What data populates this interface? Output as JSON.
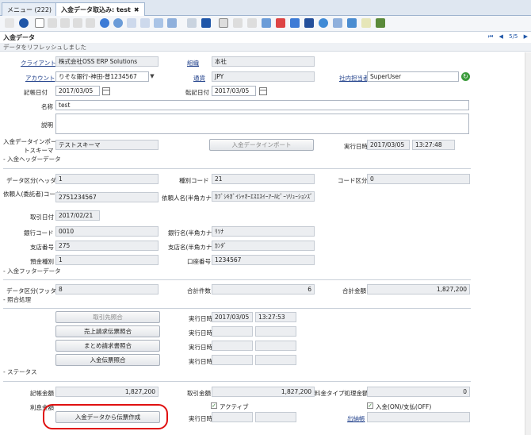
{
  "tabs": [
    {
      "label": "メニュー (222)"
    },
    {
      "label": "入金データ取込み: test",
      "close": "✖"
    }
  ],
  "header": {
    "title": "入金データ",
    "pager": {
      "count": "5/5"
    }
  },
  "status_message": "データをリフレッシュしました",
  "form": {
    "client_label": "クライアント",
    "client_value": "株式会社OSS ERP Solutions",
    "org_label": "組織",
    "org_value": "本社",
    "account_label": "アカウント",
    "account_value": "りそな銀行-神田-普1234567",
    "currency_label": "通貨",
    "currency_value": "JPY",
    "staff_label": "社内担当者",
    "staff_value": "SuperUser",
    "doc_date_label": "記帳日付",
    "doc_date_value": "2017/03/05",
    "acct_date_label": "転記日付",
    "acct_date_value": "2017/03/05",
    "name_label": "名称",
    "name_value": "test",
    "desc_label": "説明",
    "schema_label_1": "入金データインポー",
    "schema_label_2": "トスキーマ",
    "schema_value": "テストスキーマ",
    "import_button": "入金データインポート",
    "exec_label": "実行日時",
    "exec_date": "2017/03/05",
    "exec_time": "13:27:48"
  },
  "header_section": {
    "title": "- 入金ヘッダーデータ",
    "data_type_label": "データ区分(ヘッダ",
    "data_type_value": "1",
    "kind_code_label": "種別コード",
    "kind_code_value": "21",
    "code_type_label": "コード区分",
    "code_type_value": "0",
    "requester_code_label": "依頼人(委託者)コード",
    "requester_code_value": "2751234567",
    "requester_name_label": "依頼人名(半角カナ",
    "requester_name_value": "ｶﾌﾞｼｷｶﾞｲｼｬｵｰｴｽｴｽｲｰｱｰﾙﾋﾟｰｿﾘｭｰｼｮﾝｽﾞ",
    "trade_date_label": "取引日付",
    "trade_date_value": "2017/02/21",
    "bank_code_label": "銀行コード",
    "bank_code_value": "0010",
    "bank_name_label": "銀行名(半角カナ",
    "bank_name_value": "ﾘｿﾅ",
    "branch_no_label": "支店番号",
    "branch_no_value": "275",
    "branch_name_label": "支店名(半角カナ",
    "branch_name_value": "ｶﾝﾀﾞ",
    "deposit_type_label": "預金種別",
    "deposit_type_value": "1",
    "account_no_label": "口座番号",
    "account_no_value": "1234567"
  },
  "footer_section": {
    "title": "- 入金フッターデータ",
    "data_type_label": "データ区分(フッタ",
    "data_type_value": "8",
    "total_count_label": "合計件数",
    "total_count_value": "6",
    "total_amount_label": "合計金額",
    "total_amount_value": "1,827,200"
  },
  "match_section": {
    "title": "- 照合処理",
    "btn1": "取引先照合",
    "btn2": "売上請求伝票照合",
    "btn3": "まとめ請求書照合",
    "btn4": "入金伝票照合",
    "exec_label": "実行日時",
    "exec_date": "2017/03/05",
    "exec_time": "13:27:53"
  },
  "status_section": {
    "title": "- ステータス",
    "booked_label": "記帳金額",
    "booked_value": "1,827,200",
    "trade_amt_label": "取引金額",
    "trade_amt_value": "1,827,200",
    "fee_label": "料金タイプ処理金額",
    "fee_value": "0",
    "interest_label": "利息金額",
    "active_label": "アクティブ",
    "active_check": "✓",
    "inout_label": "入金(ON)/支払(OFF)",
    "inout_check": "✓",
    "create_btn": "入金データから伝票作成",
    "exec_label": "実行日時",
    "slip_label": "出納帳"
  }
}
